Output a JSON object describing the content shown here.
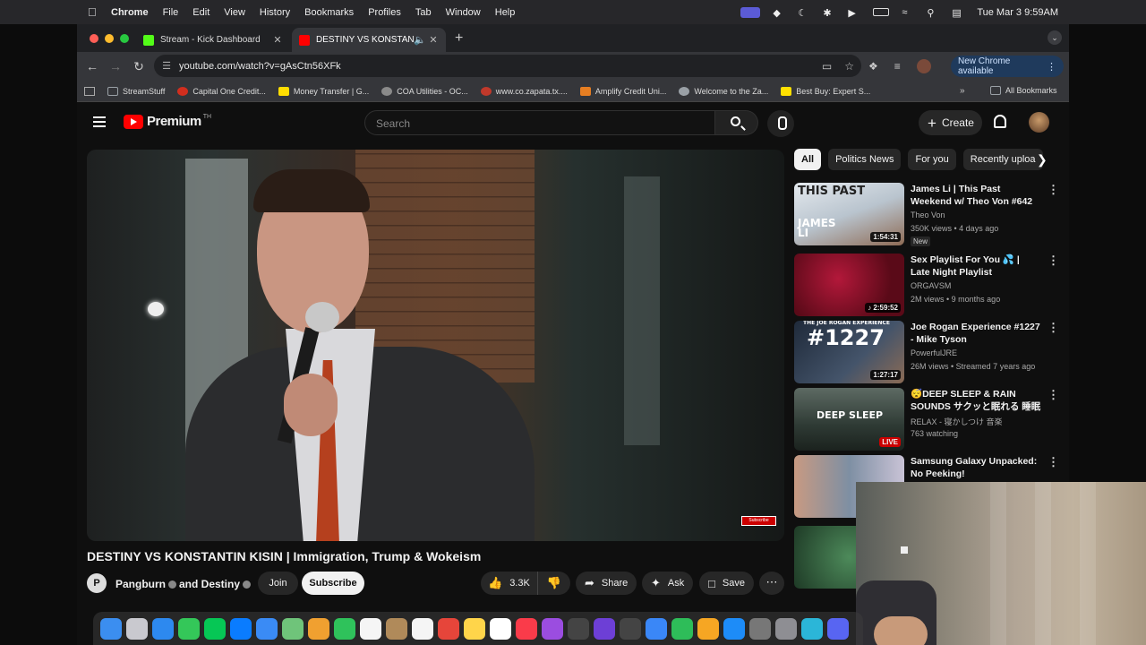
{
  "menubar": {
    "app": "Chrome",
    "items": [
      "File",
      "Edit",
      "View",
      "History",
      "Bookmarks",
      "Profiles",
      "Tab",
      "Window",
      "Help"
    ],
    "clock": "Tue Mar 3  9:59AM"
  },
  "tabs": [
    {
      "title": "Stream - Kick Dashboard",
      "favicon_color": "#53fc18"
    },
    {
      "title": "DESTINY VS KONSTANTIN",
      "favicon_color": "#ff0000"
    }
  ],
  "address": {
    "url": "youtube.com/watch?v=gAsCtn56XFk"
  },
  "toolbar": {
    "new_chrome": "New Chrome available"
  },
  "bookmarks": [
    {
      "label": "StreamStuff",
      "color": "#9aa0a6"
    },
    {
      "label": "Capital One Credit...",
      "color": "#d22e1e"
    },
    {
      "label": "Money Transfer | G...",
      "color": "#ffdd00"
    },
    {
      "label": "COA Utilities - OC...",
      "color": "#8a8a8a"
    },
    {
      "label": "www.co.zapata.tx....",
      "color": "#c0392b"
    },
    {
      "label": "Amplify Credit Uni...",
      "color": "#e67e22"
    },
    {
      "label": "Welcome to the Za...",
      "color": "#9aa0a6"
    },
    {
      "label": "Best Buy: Expert S...",
      "color": "#ffe000"
    }
  ],
  "bookmarks_more": "»",
  "bookmarks_all": "All Bookmarks",
  "youtube": {
    "logo": "Premium",
    "logo_sup": "TH",
    "search_placeholder": "Search",
    "create_label": "Create"
  },
  "video": {
    "title": "DESTINY VS KONSTANTIN KISIN | Immigration, Trump & Wokeism",
    "channel": "Pangburn",
    "collab": "and Destiny",
    "join_label": "Join",
    "subscribe_label": "Subscribe",
    "likes": "3.3K",
    "share_label": "Share",
    "ask_label": "Ask",
    "save_label": "Save",
    "overlay_badge": "Subscribe"
  },
  "chips": [
    "All",
    "Politics News",
    "For you",
    "Recently uploa"
  ],
  "recommendations": [
    {
      "title": "James Li | This Past Weekend w/ Theo Von #642",
      "channel": "Theo Von",
      "meta": "350K views • 4 days ago",
      "badge": "New",
      "duration": "1:54:31",
      "thumb_text": "JAMES LI",
      "thumb_color": "#cfd8e0"
    },
    {
      "title": "Sex Playlist For You 💦 | Late Night Playlist",
      "channel": "ORGAVSM",
      "meta": "2M views • 9 months ago",
      "duration": "♪ 2:59:52",
      "thumb_color": "#7a1022"
    },
    {
      "title": "Joe Rogan Experience #1227 - Mike Tyson",
      "channel": "PowerfulJRE",
      "meta": "26M views • Streamed 7 years ago",
      "duration": "1:27:17",
      "thumb_text": "#1227",
      "thumb_color": "#2b3646"
    },
    {
      "title": "😴DEEP SLEEP & RAIN SOUNDS サクッと眠れる 睡眠用BGM...",
      "channel": "RELAX - 寝かしつけ 音楽",
      "meta": "763 watching",
      "live": "LIVE",
      "thumb_text": "DEEP SLEEP",
      "thumb_color": "#3c4a44"
    },
    {
      "title": "Samsung Galaxy Unpacked: No Peeking!",
      "channel": "",
      "meta": "",
      "thumb_color": "#6a7a8a"
    }
  ]
}
